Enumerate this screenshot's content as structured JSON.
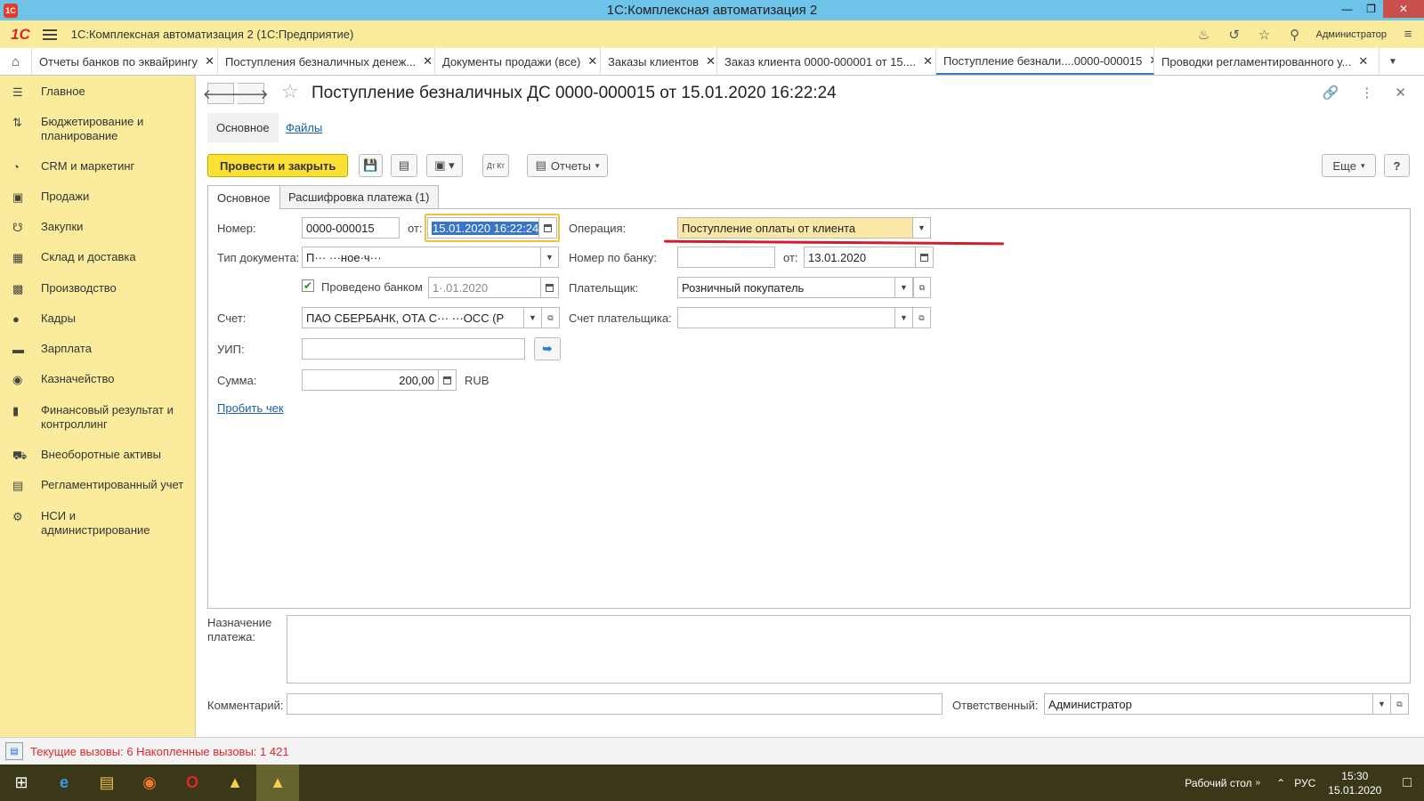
{
  "window": {
    "title": "1С:Комплексная автоматизация 2",
    "app_icon": "1C",
    "controls": [
      "minimize-icon",
      "restore-icon",
      "close-icon"
    ]
  },
  "app_toolbar": {
    "logo": "1С",
    "app_name": "1С:Комплексная автоматизация 2  (1С:Предприятие)",
    "user": "Администратор",
    "icons": [
      "bell-icon",
      "history-icon",
      "star-icon",
      "search-icon",
      "menu-icon"
    ]
  },
  "tabs": [
    {
      "label": "Отчеты банков по эквайрингу"
    },
    {
      "label": "Поступления безналичных денеж..."
    },
    {
      "label": "Документы продажи (все)"
    },
    {
      "label": "Заказы клиентов"
    },
    {
      "label": "Заказ клиента 0000-000001 от 15...."
    },
    {
      "label": "Поступление безнали....0000-000015",
      "active": true
    },
    {
      "label": "Проводки регламентированного у..."
    }
  ],
  "sidebar": {
    "items": [
      {
        "label": "Главное",
        "icon": "menu-icon"
      },
      {
        "label": "Бюджетирование и планирование",
        "icon": "budget-icon"
      },
      {
        "label": "CRM и маркетинг",
        "icon": "pie-icon"
      },
      {
        "label": "Продажи",
        "icon": "bag-icon"
      },
      {
        "label": "Закупки",
        "icon": "cart-icon"
      },
      {
        "label": "Склад и доставка",
        "icon": "warehouse-icon"
      },
      {
        "label": "Производство",
        "icon": "factory-icon"
      },
      {
        "label": "Кадры",
        "icon": "person-icon"
      },
      {
        "label": "Зарплата",
        "icon": "wallet-icon"
      },
      {
        "label": "Казначейство",
        "icon": "coin-icon"
      },
      {
        "label": "Финансовый результат и контроллинг",
        "icon": "bars-icon"
      },
      {
        "label": "Внеоборотные активы",
        "icon": "truck-icon"
      },
      {
        "label": "Регламентированный учет",
        "icon": "ledger-icon"
      },
      {
        "label": "НСИ и администрирование",
        "icon": "gear-icon"
      }
    ]
  },
  "form": {
    "title": "Поступление безналичных ДС 0000-000015 от 15.01.2020 16:22:24",
    "subnav": {
      "main": "Основное",
      "files": "Файлы"
    },
    "toolbar": {
      "post_close": "Провести и закрыть",
      "reports": "Отчеты",
      "more": "Еще",
      "help": "?",
      "dtkt": "Дт Кт"
    },
    "tabs": [
      {
        "label": "Основное",
        "active": true
      },
      {
        "label": "Расшифровка платежа (1)"
      }
    ],
    "fields": {
      "number_label": "Номер:",
      "number": "0000-000015",
      "from_label": "от:",
      "date": "15.01.2020 16:22:24",
      "operation_label": "Операция:",
      "operation": "Поступление оплаты от клиента",
      "doc_type_label": "Тип документа:",
      "doc_type": "П···  ···ное·ч···",
      "bank_number_label": "Номер по банку:",
      "bank_number": "",
      "bank_from_label": "от:",
      "bank_date": "13.01.2020",
      "posted_by_bank_label": "Проведено банком",
      "posted_by_bank": true,
      "posted_date": "1·.01.2020",
      "payer_label": "Плательщик:",
      "payer": "Розничный покупатель",
      "account_label": "Счет:",
      "account": "ПАО СБЕРБАНК, ОТА С···  ···ОСС (Р",
      "payer_account_label": "Счет плательщика:",
      "payer_account": "",
      "uip_label": "УИП:",
      "uip": "",
      "sum_label": "Сумма:",
      "sum": "200,00",
      "currency": "RUB",
      "print_receipt": "Пробить чек",
      "purpose_label": "Назначение платежа:",
      "purpose": "",
      "comment_label": "Комментарий:",
      "comment": "",
      "responsible_label": "Ответственный:",
      "responsible": "Администратор"
    }
  },
  "statusbar": {
    "text": "Текущие вызовы: 6   Накопленные вызовы: 1 421"
  },
  "taskbar": {
    "apps": [
      "windows-start-icon",
      "edge-icon",
      "explorer-icon",
      "firefox-icon",
      "opera-icon",
      "app-1c-icon",
      "app-1c-active-icon"
    ],
    "desktop": "Рабочий стол",
    "lang": "РУС",
    "time": "15:30",
    "date": "15.01.2020"
  },
  "colors": {
    "accent_yellow": "#fbec9d",
    "primary_button": "#fbe035",
    "titlebar": "#6ec3e8",
    "selection": "#3874c7",
    "annotation_red": "#d01f2a"
  }
}
